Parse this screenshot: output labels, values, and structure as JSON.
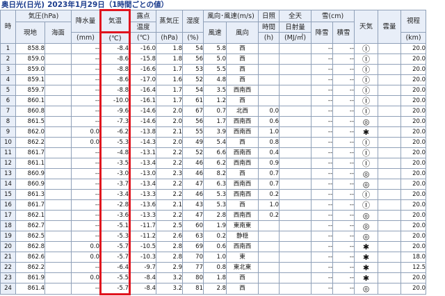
{
  "title": {
    "place": "奥日光(日光)",
    "date": "2023年1月29日（1時間ごとの値）"
  },
  "headers": {
    "hour": "時",
    "pressure": "気圧(hPa)",
    "pressure_station": "現地",
    "pressure_sea": "海面",
    "precip": "降水量",
    "precip_unit": "(mm)",
    "temp": "気温",
    "temp_unit": "(℃)",
    "dew": "露点",
    "dew2": "温度",
    "dew_unit": "(℃)",
    "vapor": "蒸気圧",
    "vapor_unit": "(hPa)",
    "humidity": "湿度",
    "humidity_unit": "(%)",
    "wind": "風向･風速(m/s)",
    "wind_speed": "風速",
    "wind_dir": "風向",
    "sunshine": "日照",
    "sunshine2": "時間",
    "sunshine_unit": "(h)",
    "radiation": "全天",
    "radiation2": "日射量",
    "radiation_unit": "(MJ/㎡)",
    "snow": "雪(cm)",
    "snowfall": "降雪",
    "snowdepth": "積雪",
    "weather": "天気",
    "cloud": "雲量",
    "visibility": "視程",
    "visibility_unit": "(km)"
  },
  "rows": [
    {
      "hour": "1",
      "pressure": "858.8",
      "sea": "",
      "precip": "--",
      "temp": "-8.4",
      "dew": "-16.0",
      "vapor": "1.8",
      "hum": "54",
      "wspd": "5.8",
      "wdir": "西",
      "sun": "",
      "rad": "",
      "snowfall": "--",
      "snowdepth": "--",
      "weather": "Ⓘ",
      "cloud": "",
      "vis": "20.0"
    },
    {
      "hour": "2",
      "pressure": "859.0",
      "sea": "",
      "precip": "--",
      "temp": "-8.6",
      "dew": "-15.8",
      "vapor": "1.8",
      "hum": "56",
      "wspd": "5.0",
      "wdir": "西",
      "sun": "",
      "rad": "",
      "snowfall": "--",
      "snowdepth": "--",
      "weather": "Ⓘ",
      "cloud": "",
      "vis": "20.0"
    },
    {
      "hour": "3",
      "pressure": "859.0",
      "sea": "",
      "precip": "--",
      "temp": "-8.8",
      "dew": "-16.6",
      "vapor": "1.7",
      "hum": "53",
      "wspd": "5.5",
      "wdir": "西",
      "sun": "",
      "rad": "",
      "snowfall": "--",
      "snowdepth": "--",
      "weather": "Ⓘ",
      "cloud": "",
      "vis": "20.0"
    },
    {
      "hour": "4",
      "pressure": "859.1",
      "sea": "",
      "precip": "--",
      "temp": "-8.6",
      "dew": "-17.0",
      "vapor": "1.6",
      "hum": "52",
      "wspd": "4.8",
      "wdir": "西",
      "sun": "",
      "rad": "",
      "snowfall": "--",
      "snowdepth": "--",
      "weather": "Ⓘ",
      "cloud": "",
      "vis": "20.0"
    },
    {
      "hour": "5",
      "pressure": "859.7",
      "sea": "",
      "precip": "--",
      "temp": "-8.8",
      "dew": "-16.4",
      "vapor": "1.7",
      "hum": "54",
      "wspd": "3.5",
      "wdir": "西南西",
      "sun": "",
      "rad": "",
      "snowfall": "--",
      "snowdepth": "--",
      "weather": "Ⓘ",
      "cloud": "",
      "vis": "20.0"
    },
    {
      "hour": "6",
      "pressure": "860.1",
      "sea": "",
      "precip": "--",
      "temp": "-10.0",
      "dew": "-16.1",
      "vapor": "1.7",
      "hum": "61",
      "wspd": "1.2",
      "wdir": "西",
      "sun": "",
      "rad": "",
      "snowfall": "--",
      "snowdepth": "--",
      "weather": "Ⓘ",
      "cloud": "",
      "vis": "20.0"
    },
    {
      "hour": "7",
      "pressure": "860.8",
      "sea": "",
      "precip": "--",
      "temp": "-9.6",
      "dew": "-14.6",
      "vapor": "2.0",
      "hum": "67",
      "wspd": "0.7",
      "wdir": "北西",
      "sun": "0.0",
      "rad": "",
      "snowfall": "--",
      "snowdepth": "--",
      "weather": "Ⓘ",
      "cloud": "",
      "vis": "20.0"
    },
    {
      "hour": "8",
      "pressure": "861.5",
      "sea": "",
      "precip": "--",
      "temp": "-7.3",
      "dew": "-14.6",
      "vapor": "2.0",
      "hum": "56",
      "wspd": "1.7",
      "wdir": "西南西",
      "sun": "0.6",
      "rad": "",
      "snowfall": "--",
      "snowdepth": "--",
      "weather": "◎",
      "cloud": "",
      "vis": "20.0"
    },
    {
      "hour": "9",
      "pressure": "862.0",
      "sea": "",
      "precip": "0.0",
      "temp": "-6.2",
      "dew": "-13.8",
      "vapor": "2.1",
      "hum": "55",
      "wspd": "3.9",
      "wdir": "西南西",
      "sun": "1.0",
      "rad": "",
      "snowfall": "--",
      "snowdepth": "--",
      "weather": "✱",
      "cloud": "",
      "vis": "20.0"
    },
    {
      "hour": "10",
      "pressure": "862.2",
      "sea": "",
      "precip": "0.0",
      "temp": "-5.3",
      "dew": "-14.3",
      "vapor": "2.0",
      "hum": "49",
      "wspd": "5.4",
      "wdir": "西",
      "sun": "0.8",
      "rad": "",
      "snowfall": "--",
      "snowdepth": "--",
      "weather": "Ⓘ",
      "cloud": "",
      "vis": "20.0"
    },
    {
      "hour": "11",
      "pressure": "861.7",
      "sea": "",
      "precip": "--",
      "temp": "-4.8",
      "dew": "-13.1",
      "vapor": "2.2",
      "hum": "52",
      "wspd": "6.6",
      "wdir": "西南西",
      "sun": "0.4",
      "rad": "",
      "snowfall": "--",
      "snowdepth": "--",
      "weather": "Ⓘ",
      "cloud": "",
      "vis": "20.0"
    },
    {
      "hour": "12",
      "pressure": "861.1",
      "sea": "",
      "precip": "--",
      "temp": "-3.5",
      "dew": "-13.4",
      "vapor": "2.2",
      "hum": "46",
      "wspd": "6.2",
      "wdir": "西南西",
      "sun": "0.9",
      "rad": "",
      "snowfall": "--",
      "snowdepth": "--",
      "weather": "Ⓘ",
      "cloud": "",
      "vis": "20.0"
    },
    {
      "hour": "13",
      "pressure": "860.9",
      "sea": "",
      "precip": "--",
      "temp": "-3.0",
      "dew": "-13.0",
      "vapor": "2.3",
      "hum": "46",
      "wspd": "8.2",
      "wdir": "西",
      "sun": "0.7",
      "rad": "",
      "snowfall": "--",
      "snowdepth": "--",
      "weather": "◎",
      "cloud": "",
      "vis": "20.0"
    },
    {
      "hour": "14",
      "pressure": "860.9",
      "sea": "",
      "precip": "--",
      "temp": "-3.7",
      "dew": "-13.4",
      "vapor": "2.2",
      "hum": "47",
      "wspd": "6.3",
      "wdir": "西南西",
      "sun": "0.7",
      "rad": "",
      "snowfall": "--",
      "snowdepth": "--",
      "weather": "◎",
      "cloud": "",
      "vis": "20.0"
    },
    {
      "hour": "15",
      "pressure": "861.3",
      "sea": "",
      "precip": "--",
      "temp": "-3.4",
      "dew": "-13.3",
      "vapor": "2.2",
      "hum": "46",
      "wspd": "5.3",
      "wdir": "西南西",
      "sun": "0.2",
      "rad": "",
      "snowfall": "--",
      "snowdepth": "--",
      "weather": "Ⓘ",
      "cloud": "",
      "vis": "20.0"
    },
    {
      "hour": "16",
      "pressure": "861.7",
      "sea": "",
      "precip": "--",
      "temp": "-2.8",
      "dew": "-13.6",
      "vapor": "2.1",
      "hum": "43",
      "wspd": "5.3",
      "wdir": "西",
      "sun": "1.0",
      "rad": "",
      "snowfall": "--",
      "snowdepth": "--",
      "weather": "Ⓘ",
      "cloud": "",
      "vis": "20.0"
    },
    {
      "hour": "17",
      "pressure": "862.1",
      "sea": "",
      "precip": "--",
      "temp": "-3.6",
      "dew": "-13.3",
      "vapor": "2.2",
      "hum": "47",
      "wspd": "2.8",
      "wdir": "西南西",
      "sun": "0.2",
      "rad": "",
      "snowfall": "--",
      "snowdepth": "--",
      "weather": "◎",
      "cloud": "",
      "vis": "20.0"
    },
    {
      "hour": "18",
      "pressure": "862.7",
      "sea": "",
      "precip": "--",
      "temp": "-5.1",
      "dew": "-11.7",
      "vapor": "2.5",
      "hum": "60",
      "wspd": "1.9",
      "wdir": "東南東",
      "sun": "",
      "rad": "",
      "snowfall": "--",
      "snowdepth": "--",
      "weather": "◎",
      "cloud": "",
      "vis": "20.0"
    },
    {
      "hour": "19",
      "pressure": "862.5",
      "sea": "",
      "precip": "--",
      "temp": "-5.3",
      "dew": "-11.2",
      "vapor": "2.6",
      "hum": "63",
      "wspd": "0.2",
      "wdir": "静穏",
      "sun": "",
      "rad": "",
      "snowfall": "--",
      "snowdepth": "--",
      "weather": "◎",
      "cloud": "",
      "vis": "20.0"
    },
    {
      "hour": "20",
      "pressure": "862.8",
      "sea": "",
      "precip": "0.0",
      "temp": "-5.7",
      "dew": "-10.5",
      "vapor": "2.8",
      "hum": "69",
      "wspd": "0.6",
      "wdir": "西南西",
      "sun": "",
      "rad": "",
      "snowfall": "--",
      "snowdepth": "--",
      "weather": "✱",
      "cloud": "",
      "vis": "20.0"
    },
    {
      "hour": "21",
      "pressure": "862.6",
      "sea": "",
      "precip": "0.0",
      "temp": "-5.7",
      "dew": "-10.3",
      "vapor": "2.8",
      "hum": "70",
      "wspd": "1.0",
      "wdir": "東",
      "sun": "",
      "rad": "",
      "snowfall": "--",
      "snowdepth": "--",
      "weather": "✱",
      "cloud": "",
      "vis": "18.0"
    },
    {
      "hour": "22",
      "pressure": "862.2",
      "sea": "",
      "precip": "--",
      "temp": "-6.4",
      "dew": "-9.7",
      "vapor": "2.9",
      "hum": "77",
      "wspd": "0.8",
      "wdir": "東北東",
      "sun": "",
      "rad": "",
      "snowfall": "--",
      "snowdepth": "--",
      "weather": "✱",
      "cloud": "",
      "vis": "12.5"
    },
    {
      "hour": "23",
      "pressure": "861.9",
      "sea": "",
      "precip": "0.0",
      "temp": "-5.5",
      "dew": "-8.4",
      "vapor": "3.2",
      "hum": "80",
      "wspd": "1.8",
      "wdir": "西",
      "sun": "",
      "rad": "",
      "snowfall": "--",
      "snowdepth": "--",
      "weather": "✱",
      "cloud": "",
      "vis": "20.0"
    },
    {
      "hour": "24",
      "pressure": "861.4",
      "sea": "",
      "precip": "--",
      "temp": "-5.7",
      "dew": "-8.4",
      "vapor": "3.2",
      "hum": "81",
      "wspd": "2.8",
      "wdir": "西",
      "sun": "",
      "rad": "",
      "snowfall": "--",
      "snowdepth": "--",
      "weather": "◎",
      "cloud": "",
      "vis": "20.0"
    }
  ]
}
